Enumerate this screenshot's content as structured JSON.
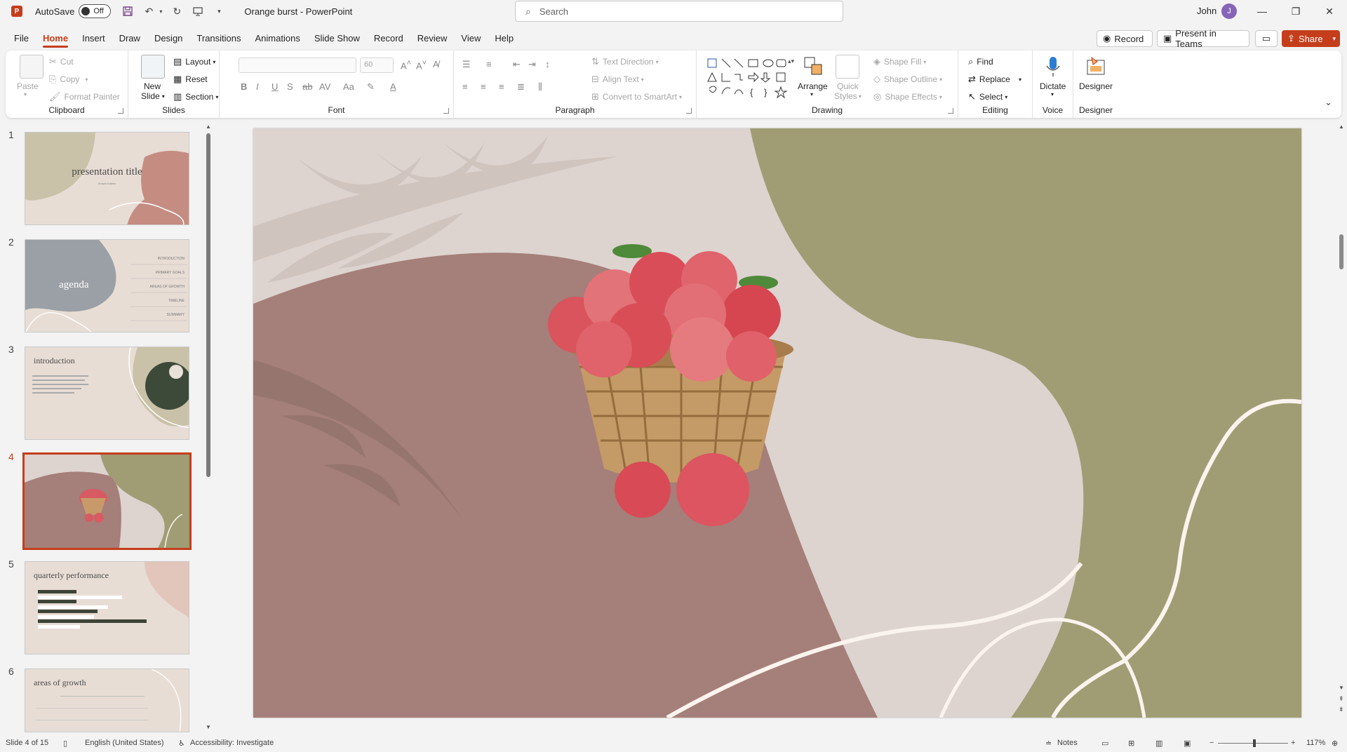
{
  "titlebar": {
    "app_icon": "P",
    "autosave_label": "AutoSave",
    "autosave_state": "Off",
    "doc_title": "Orange burst  -  PowerPoint",
    "search_placeholder": "Search",
    "user_name": "John",
    "user_initial": "J"
  },
  "menu": {
    "tabs": [
      "File",
      "Home",
      "Insert",
      "Draw",
      "Design",
      "Transitions",
      "Animations",
      "Slide Show",
      "Record",
      "Review",
      "View",
      "Help"
    ],
    "active_tab": "Home",
    "record_btn": "Record",
    "present_teams_btn": "Present in Teams",
    "share_btn": "Share"
  },
  "ribbon": {
    "clipboard": {
      "label": "Clipboard",
      "paste": "Paste",
      "cut": "Cut",
      "copy": "Copy",
      "format_painter": "Format Painter"
    },
    "slides": {
      "label": "Slides",
      "new_slide": "New",
      "new_slide2": "Slide",
      "layout": "Layout",
      "reset": "Reset",
      "section": "Section"
    },
    "font": {
      "label": "Font",
      "size": "60"
    },
    "paragraph": {
      "label": "Paragraph",
      "text_direction": "Text Direction",
      "align_text": "Align Text",
      "convert_smartart": "Convert to SmartArt"
    },
    "drawing": {
      "label": "Drawing",
      "arrange": "Arrange",
      "quick_styles": "Quick",
      "quick_styles2": "Styles",
      "shape_fill": "Shape Fill",
      "shape_outline": "Shape Outline",
      "shape_effects": "Shape Effects"
    },
    "editing": {
      "label": "Editing",
      "find": "Find",
      "replace": "Replace",
      "select": "Select"
    },
    "voice": {
      "label": "Voice",
      "dictate": "Dictate"
    },
    "designer": {
      "label": "Designer",
      "designer": "Designer"
    }
  },
  "thumbnails": [
    {
      "num": "1",
      "title": "presentation title",
      "subtitle": "Shayla Adams"
    },
    {
      "num": "2",
      "title": "agenda",
      "items": [
        "INTRODUCTION",
        "PRIMARY GOALS",
        "AREAS OF GROWTH",
        "TIMELINE",
        "SUMMARY"
      ]
    },
    {
      "num": "3",
      "title": "introduction"
    },
    {
      "num": "4",
      "title": ""
    },
    {
      "num": "5",
      "title": "quarterly performance"
    },
    {
      "num": "6",
      "title": "areas of growth"
    }
  ],
  "active_slide": "4",
  "statusbar": {
    "slide_info": "Slide 4 of 15",
    "language": "English (United States)",
    "accessibility": "Accessibility: Investigate",
    "notes": "Notes",
    "zoom": "117%"
  },
  "colors": {
    "accent": "#c43e1c",
    "slide_bg": "#ddd3cf",
    "mauve": "#a57f79",
    "olive": "#a09d75",
    "cream_line": "#fbf4ee"
  }
}
